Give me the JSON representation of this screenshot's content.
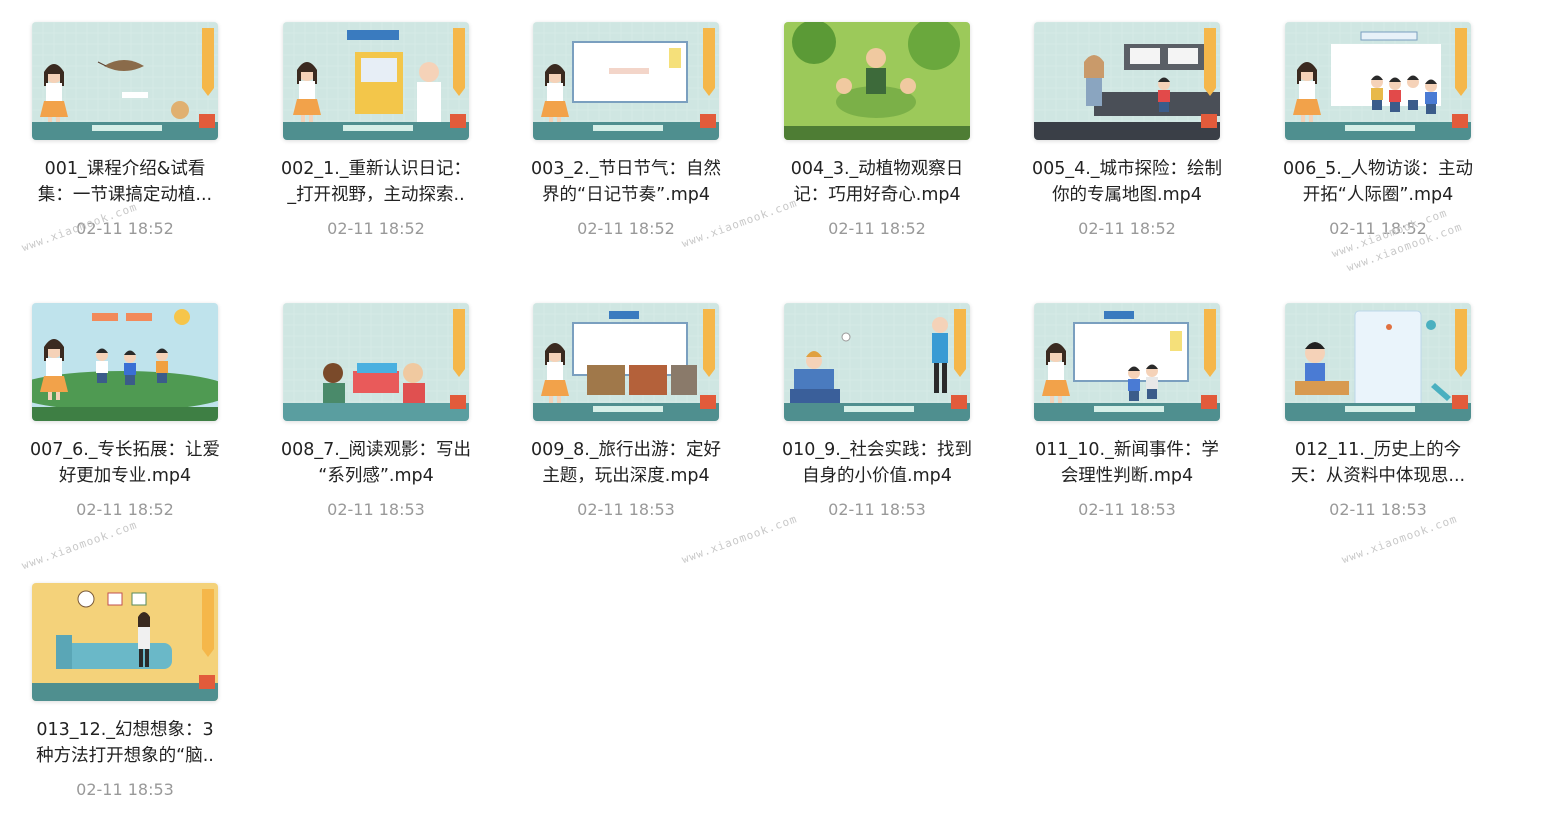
{
  "files": [
    {
      "line1": "001_课程介绍&试看",
      "line2": "集：一节课搞定动植...",
      "date": "02-11 18:52",
      "thumb_style": "insect"
    },
    {
      "line1": "002_1._重新认识日记：",
      "line2": "_打开视野，主动探索..",
      "date": "02-11 18:52",
      "thumb_style": "teacher-book"
    },
    {
      "line1": "003_2._节日节气：自然",
      "line2": "界的“日记节奏”.mp4",
      "date": "02-11 18:52",
      "thumb_style": "board"
    },
    {
      "line1": "004_3._动植物观察日",
      "line2": "记：巧用好奇心.mp4",
      "date": "02-11 18:52",
      "thumb_style": "nature"
    },
    {
      "line1": "005_4._城市探险：绘制",
      "line2": "你的专属地图.mp4",
      "date": "02-11 18:52",
      "thumb_style": "city"
    },
    {
      "line1": "006_5._人物访谈：主动",
      "line2": "开拓“人际圈”.mp4",
      "date": "02-11 18:52",
      "thumb_style": "people"
    },
    {
      "line1": "007_6._专长拓展：让爱",
      "line2": "好更加专业.mp4",
      "date": "02-11 18:52",
      "thumb_style": "kids"
    },
    {
      "line1": "008_7._阅读观影：写出",
      "line2": "“系列感”.mp4",
      "date": "02-11 18:53",
      "thumb_style": "reading"
    },
    {
      "line1": "009_8._旅行出游：定好",
      "line2": "主题，玩出深度.mp4",
      "date": "02-11 18:53",
      "thumb_style": "travel"
    },
    {
      "line1": "010_9._社会实践：找到",
      "line2": "自身的小价值.mp4",
      "date": "02-11 18:53",
      "thumb_style": "practice"
    },
    {
      "line1": "011_10._新闻事件：学",
      "line2": "会理性判断.mp4",
      "date": "02-11 18:53",
      "thumb_style": "news"
    },
    {
      "line1": "012_11._历史上的今",
      "line2": "天：从资料中体现思...",
      "date": "02-11 18:53",
      "thumb_style": "history"
    },
    {
      "line1": "013_12._幻想想象：3",
      "line2": "种方法打开想象的“脑..",
      "date": "02-11 18:53",
      "thumb_style": "room"
    }
  ],
  "watermark": "www.xiaomook.com",
  "colors": {
    "thumb_bg": "#cfe6e2",
    "thumb_floor": "#4f8f8f",
    "date_text": "#999999",
    "name_text": "#222222"
  }
}
